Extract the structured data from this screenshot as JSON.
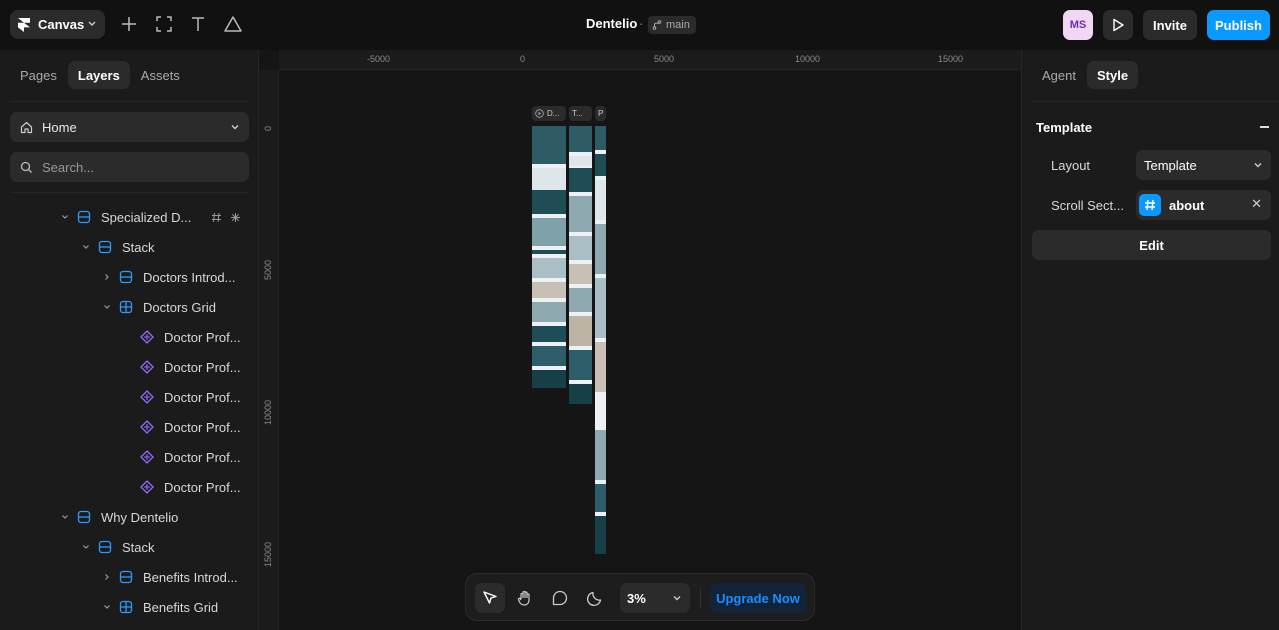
{
  "topbar": {
    "canvas_label": "Canvas",
    "doc_title": "Dentelio",
    "doc_separator": "·",
    "branch": "main",
    "avatar_initials": "MS",
    "invite_label": "Invite",
    "publish_label": "Publish"
  },
  "left_panel": {
    "tabs": [
      {
        "label": "Pages"
      },
      {
        "label": "Layers"
      },
      {
        "label": "Assets"
      }
    ],
    "page_select": "Home",
    "search_placeholder": "Search...",
    "layers": [
      {
        "label": "Specialized D...",
        "icon": "stack-icon"
      },
      {
        "label": "Stack",
        "icon": "stack-icon"
      },
      {
        "label": "Doctors Introd...",
        "icon": "stack-icon"
      },
      {
        "label": "Doctors Grid",
        "icon": "grid-icon"
      },
      {
        "label": "Doctor Prof...",
        "icon": "component-icon"
      },
      {
        "label": "Doctor Prof...",
        "icon": "component-icon"
      },
      {
        "label": "Doctor Prof...",
        "icon": "component-icon"
      },
      {
        "label": "Doctor Prof...",
        "icon": "component-icon"
      },
      {
        "label": "Doctor Prof...",
        "icon": "component-icon"
      },
      {
        "label": "Doctor Prof...",
        "icon": "component-icon"
      },
      {
        "label": "Why Dentelio",
        "icon": "stack-icon"
      },
      {
        "label": "Stack",
        "icon": "stack-icon"
      },
      {
        "label": "Benefits Introd...",
        "icon": "stack-icon"
      },
      {
        "label": "Benefits Grid",
        "icon": "grid-icon"
      }
    ]
  },
  "canvas": {
    "ruler_top": [
      "-5000",
      "0",
      "5000",
      "10000",
      "15000"
    ],
    "ruler_left": [
      "0",
      "5000",
      "10000",
      "15000"
    ],
    "frames": [
      {
        "label": "D..."
      },
      {
        "label": "T..."
      },
      {
        "label": "P"
      }
    ]
  },
  "toolbar": {
    "zoom": "3%",
    "upgrade_label": "Upgrade Now"
  },
  "right_panel": {
    "tabs": [
      {
        "label": "Agent"
      },
      {
        "label": "Style"
      }
    ],
    "section_title": "Template",
    "layout_label": "Layout",
    "layout_value": "Template",
    "scroll_label": "Scroll Sect...",
    "scroll_value": "about",
    "edit_label": "Edit"
  },
  "colors": {
    "accent": "#0a99ff",
    "background": "#111111",
    "panel": "#1b1b1b",
    "layer_icon_blue": "#2f9bff",
    "component_purple": "#9b6bff"
  }
}
